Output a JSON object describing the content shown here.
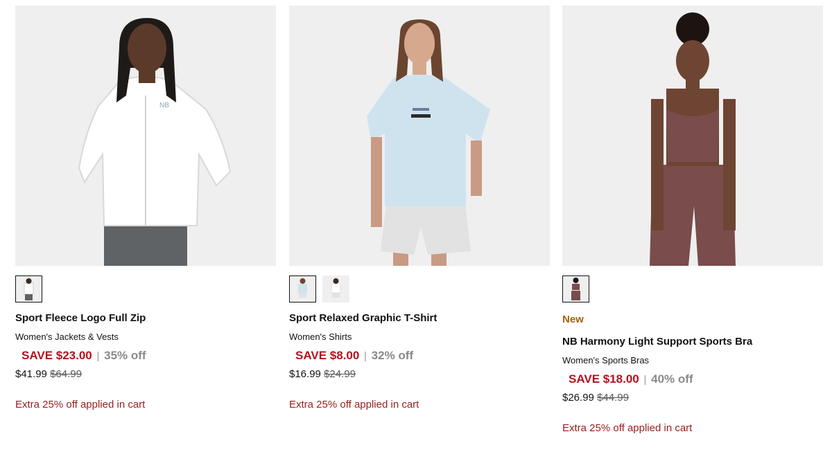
{
  "products": [
    {
      "name": "Sport Fleece Logo Full Zip",
      "category": "Women's Jackets & Vests",
      "badge": "",
      "save": "SAVE $23.00",
      "percent_off": "35% off",
      "price": "$41.99",
      "original_price": "$64.99",
      "promo": "Extra 25% off applied in cart",
      "swatch_count": 1
    },
    {
      "name": "Sport Relaxed Graphic T-Shirt",
      "category": "Women's Shirts",
      "badge": "",
      "save": "SAVE $8.00",
      "percent_off": "32% off",
      "price": "$16.99",
      "original_price": "$24.99",
      "promo": "Extra 25% off applied in cart",
      "swatch_count": 2
    },
    {
      "name": "NB Harmony Light Support Sports Bra",
      "category": "Women's Sports Bras",
      "badge": "New",
      "save": "SAVE $18.00",
      "percent_off": "40% off",
      "price": "$26.99",
      "original_price": "$44.99",
      "promo": "Extra 25% off applied in cart",
      "swatch_count": 1
    }
  ],
  "separator": "|",
  "colors": {
    "save_red": "#b3121d",
    "promo_red": "#9b1c1c",
    "new_badge": "#a3620a",
    "photo_bg": "#efefef"
  }
}
